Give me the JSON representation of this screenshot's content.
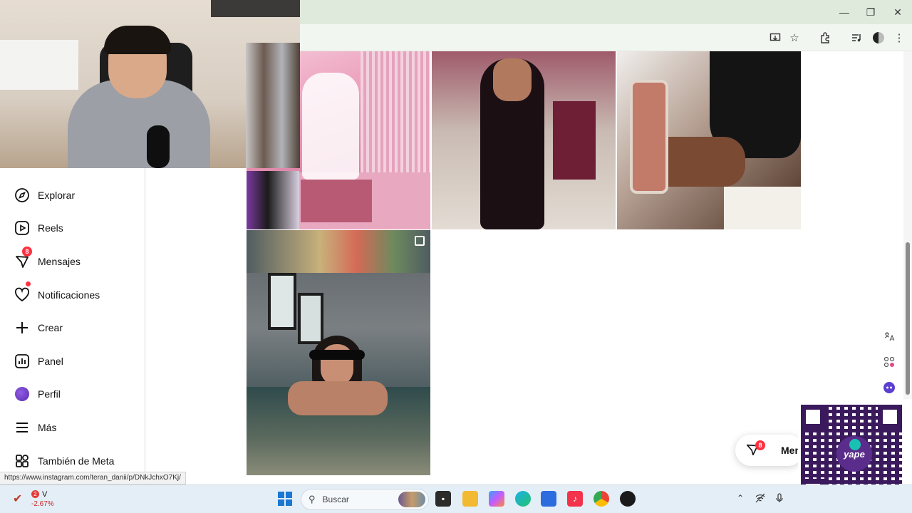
{
  "browser": {
    "window_controls": {
      "minimize": "—",
      "restore": "❐",
      "close": "✕"
    },
    "toolbar_icons": [
      "install-icon",
      "bookmark-star-icon",
      "extensions-icon",
      "media-icon",
      "profile-icon",
      "menu-icon"
    ]
  },
  "sidebar": {
    "items": [
      {
        "label": "Explorar",
        "icon": "compass-icon"
      },
      {
        "label": "Reels",
        "icon": "reels-icon"
      },
      {
        "label": "Mensajes",
        "icon": "messenger-icon",
        "badge": "8"
      },
      {
        "label": "Notificaciones",
        "icon": "heart-icon"
      },
      {
        "label": "Crear",
        "icon": "plus-icon"
      },
      {
        "label": "Panel",
        "icon": "dashboard-icon"
      },
      {
        "label": "Perfil",
        "icon": "avatar"
      },
      {
        "label": "Más",
        "icon": "hamburger-icon"
      },
      {
        "label": "También de Meta",
        "icon": "meta-apps-icon"
      }
    ]
  },
  "messages_pill": {
    "label": "Mensa",
    "badge": "8"
  },
  "qr": {
    "brand": "yape"
  },
  "status_url": "https://www.instagram.com/teran_danii/p/DNkJchxO7Kj/",
  "taskbar": {
    "stock": {
      "badge": "2",
      "name": "V",
      "change": "-2.67%"
    },
    "search_placeholder": "Buscar"
  },
  "colors": {
    "notification_red": "#ff3040",
    "chrome_green": "#dfeadc",
    "taskbar": "#e4eef6"
  }
}
